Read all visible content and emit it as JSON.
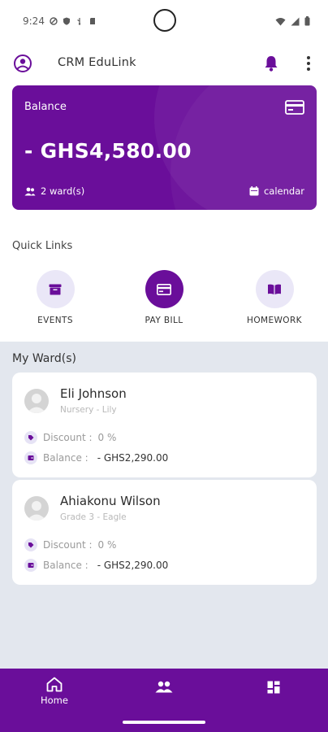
{
  "status_bar": {
    "time": "9:24"
  },
  "header": {
    "title": "CRM EduLink"
  },
  "balance_card": {
    "label": "Balance",
    "amount": "- GHS4,580.00",
    "wards": "2 ward(s)",
    "calendar": "calendar"
  },
  "quick_links": {
    "title": "Quick Links",
    "items": [
      {
        "label": "EVENTS",
        "icon": "archive-box-icon",
        "active": false
      },
      {
        "label": "PAY BILL",
        "icon": "credit-card-icon",
        "active": true
      },
      {
        "label": "HOMEWORK",
        "icon": "open-book-icon",
        "active": false
      }
    ]
  },
  "wards": {
    "title": "My Ward(s)",
    "items": [
      {
        "name": "Eli Johnson",
        "class": "Nursery - Lily",
        "discount_label": "Discount :",
        "discount": "0 %",
        "balance_label": "Balance :",
        "balance": "- GHS2,290.00"
      },
      {
        "name": "Ahiakonu Wilson",
        "class": "Grade 3 - Eagle",
        "discount_label": "Discount :",
        "discount": "0 %",
        "balance_label": "Balance :",
        "balance": "- GHS2,290.00"
      }
    ]
  },
  "bottom_nav": {
    "home_label": "Home",
    "items": [
      "home-icon",
      "people-icon",
      "dashboard-grid-icon"
    ]
  },
  "colors": {
    "brand": "#6a0e9a",
    "soft": "#eae7f7",
    "section_bg": "#e3e7ee"
  }
}
